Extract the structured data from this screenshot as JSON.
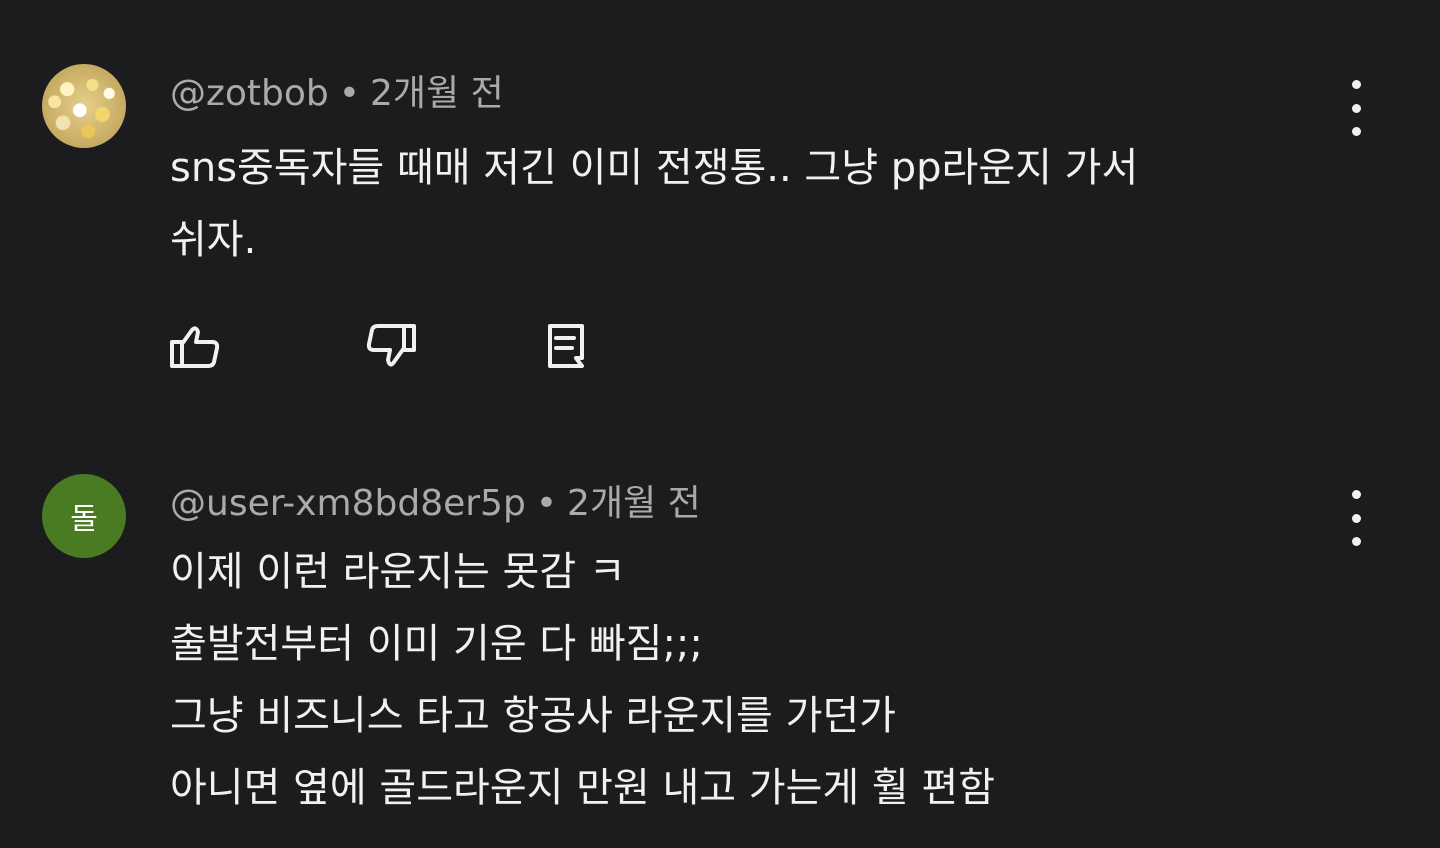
{
  "comments": [
    {
      "author": "@zotbob",
      "time": "2개월 전",
      "separator": "•",
      "avatar_letter": "",
      "avatar_color": "#c9a94f",
      "lines": [
        "sns중독자들 때매 저긴 이미 전쟁통.. 그냥 pp라운지 가서",
        "쉬자."
      ],
      "actions": {
        "like_icon": "thumbs-up-icon",
        "dislike_icon": "thumbs-down-icon",
        "reply_icon": "reply-comment-icon"
      }
    },
    {
      "author": "@user-xm8bd8er5p",
      "time": "2개월 전",
      "separator": "•",
      "avatar_letter": "돌",
      "avatar_color": "#4a7a22",
      "lines": [
        "이제 이런 라운지는 못감 ㅋ",
        "출발전부터 이미 기운 다 빠짐;;;",
        "그냥 비즈니스 타고 항공사 라운지를 가던가",
        "아니면 옆에 골드라운지 만원 내고 가는게 훨 편함"
      ]
    }
  ],
  "colors": {
    "background": "#1c1c1e",
    "text_primary": "#f1f1f1",
    "text_secondary": "#aaaaaa"
  }
}
